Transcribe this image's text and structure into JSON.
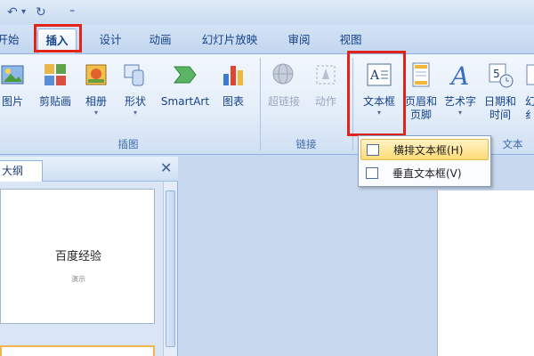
{
  "quick_access": {
    "undo": "↶",
    "undo_arrow": "▾",
    "redo": "↻",
    "more": "⁼"
  },
  "tabs": [
    {
      "label": "开始"
    },
    {
      "label": "插入"
    },
    {
      "label": "设计"
    },
    {
      "label": "动画"
    },
    {
      "label": "幻灯片放映"
    },
    {
      "label": "审阅"
    },
    {
      "label": "视图"
    }
  ],
  "ribbon": {
    "groups": [
      {
        "label": "插图"
      },
      {
        "label": "链接"
      },
      {
        "label": "文本"
      }
    ],
    "buttons": {
      "picture": "图片",
      "clipart": "剪贴画",
      "album": "相册",
      "shapes": "形状",
      "smartart": "SmartArt",
      "chart": "图表",
      "hyperlink": "超链接",
      "action": "动作",
      "textbox": "文本框",
      "header_line1": "页眉和",
      "header_line2": "页脚",
      "wordart": "艺术字",
      "datetime_line1": "日期和",
      "datetime_line2": "时间",
      "slidenum_line1": "幻",
      "slidenum_line2": "纟",
      "dropdown_arrow": "▾"
    }
  },
  "dropdown": {
    "items": [
      {
        "label": "横排文本框(H)"
      },
      {
        "label": "垂直文本框(V)"
      }
    ]
  },
  "panel": {
    "tab_label": "大纲",
    "close": "✕",
    "slide_title": "百度经验",
    "slide_subtitle": "演示"
  },
  "colors": {
    "highlight": "#e2231a",
    "ribbon_text": "#15428b"
  }
}
